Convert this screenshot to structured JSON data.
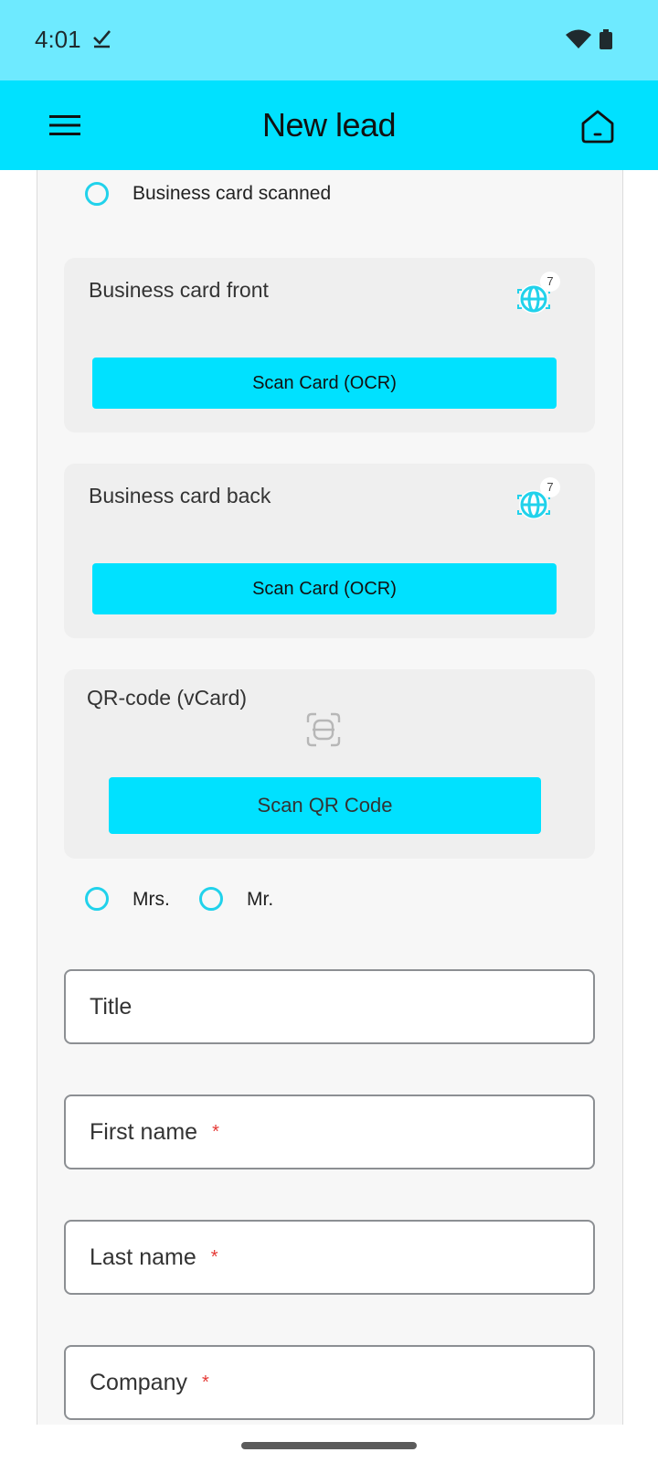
{
  "status_bar": {
    "time": "4:01",
    "icons": [
      "check-icon",
      "wifi-icon",
      "battery-icon"
    ]
  },
  "app_bar": {
    "title": "New lead",
    "menu_icon": "hamburger-menu-icon",
    "home_icon": "home-icon",
    "color": "#00e1ff"
  },
  "colors": {
    "accent": "#00e1ff",
    "status_bar": "#6eeaff",
    "radio": "#21d2eb",
    "required": "#e53935"
  },
  "form": {
    "business_card_scanned_label": "Business card scanned",
    "cards": [
      {
        "title": "Business card front",
        "icon": "ocr-globe-icon",
        "badge": "7",
        "button_label": "Scan Card (OCR)"
      },
      {
        "title": "Business card back",
        "icon": "ocr-globe-icon",
        "badge": "7",
        "button_label": "Scan Card (OCR)"
      },
      {
        "title": "QR-code (vCard)",
        "icon": "qr-scan-icon",
        "button_label": "Scan QR Code"
      }
    ],
    "salutation": [
      "Mrs.",
      "Mr."
    ],
    "fields": [
      {
        "label": "Title",
        "required": ""
      },
      {
        "label": "First name",
        "required": "*"
      },
      {
        "label": "Last name",
        "required": "*"
      },
      {
        "label": "Company",
        "required": "*"
      }
    ]
  }
}
